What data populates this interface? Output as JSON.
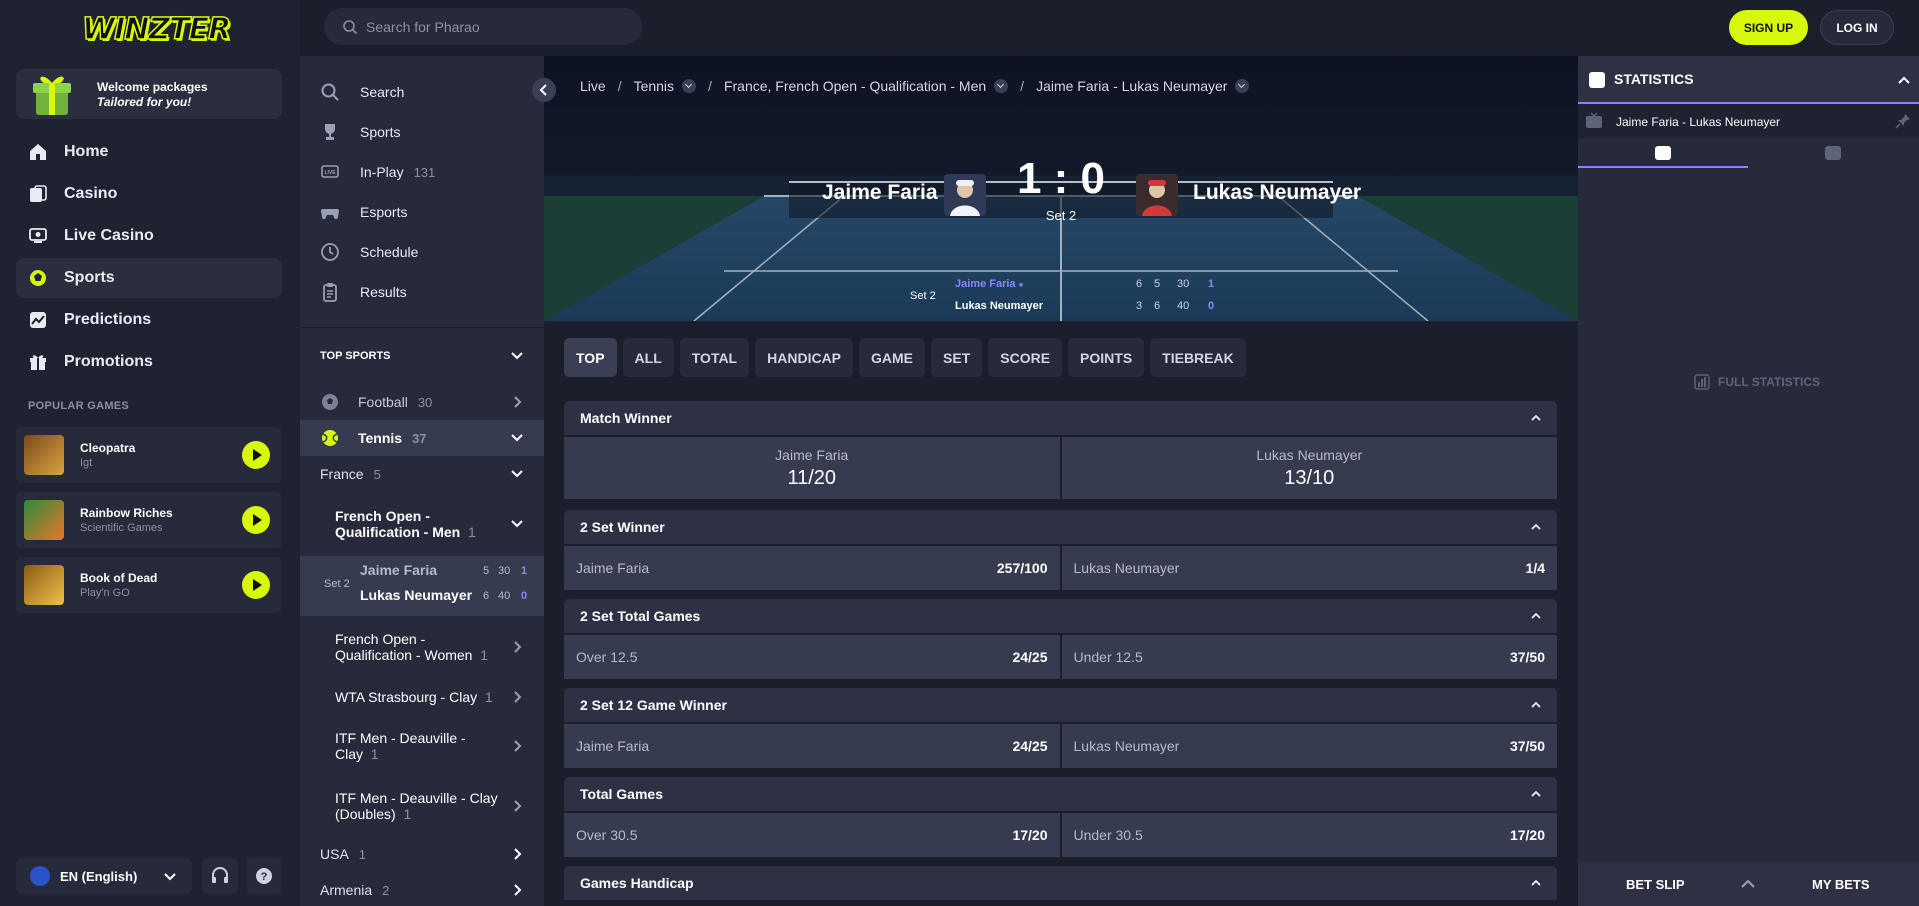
{
  "brand": {
    "logo_text": "WINZTER"
  },
  "promo": {
    "line1": "Welcome packages",
    "line2": "Tailored for you!"
  },
  "main_nav": [
    {
      "label": "Home",
      "icon": "home-icon"
    },
    {
      "label": "Casino",
      "icon": "casino-icon"
    },
    {
      "label": "Live Casino",
      "icon": "live-casino-icon"
    },
    {
      "label": "Sports",
      "icon": "sports-ball-icon",
      "active": true
    },
    {
      "label": "Predictions",
      "icon": "predictions-icon"
    },
    {
      "label": "Promotions",
      "icon": "gift-icon"
    }
  ],
  "popular_games": {
    "title": "POPULAR GAMES",
    "items": [
      {
        "name": "Cleopatra",
        "provider": "Igt"
      },
      {
        "name": "Rainbow Riches",
        "provider": "Scientific Games"
      },
      {
        "name": "Book of Dead",
        "provider": "Play'n GO"
      }
    ]
  },
  "language": {
    "label": "EN (English)"
  },
  "topbar": {
    "search_placeholder": "Search for Pharao",
    "signup_label": "SIGN UP",
    "login_label": "LOG IN"
  },
  "sports_nav": {
    "quick": [
      {
        "label": "Search",
        "icon": "search-icon"
      },
      {
        "label": "Sports",
        "icon": "trophy-icon"
      },
      {
        "label": "In-Play",
        "count": "131",
        "icon": "live-icon"
      },
      {
        "label": "Esports",
        "icon": "gamepad-icon"
      },
      {
        "label": "Schedule",
        "icon": "clock-icon"
      },
      {
        "label": "Results",
        "icon": "clipboard-icon"
      }
    ],
    "top_sports_title": "TOP SPORTS",
    "football": {
      "label": "Football",
      "count": "30"
    },
    "tennis": {
      "label": "Tennis",
      "count": "37"
    },
    "france": {
      "label": "France",
      "count": "5"
    },
    "tournament": {
      "label": "French Open - Qualification - Men",
      "count": "1"
    },
    "live_match": {
      "set": "Set 2",
      "player1": "Jaime Faria",
      "player2": "Lukas Neumayer",
      "p1_games": "5",
      "p1_points": "30",
      "p1_sets": "1",
      "p2_games": "6",
      "p2_points": "40",
      "p2_sets": "0"
    },
    "others": [
      {
        "label": "French Open - Qualification - Women",
        "count": "1"
      },
      {
        "label": "WTA Strasbourg - Clay",
        "count": "1"
      },
      {
        "label": "ITF Men - Deauville - Clay",
        "count": "1"
      },
      {
        "label": "ITF Men - Deauville - Clay (Doubles)",
        "count": "1"
      }
    ],
    "countries": [
      {
        "label": "USA",
        "count": "1"
      },
      {
        "label": "Armenia",
        "count": "2"
      }
    ]
  },
  "breadcrumb": [
    "Live",
    "Tennis",
    "France, French Open - Qualification - Men",
    "Jaime Faria - Lukas Neumayer"
  ],
  "scoreboard": {
    "home": "Jaime Faria",
    "away": "Lukas Neumayer",
    "score": "1 : 0",
    "set_label": "Set 2",
    "detail_set": "Set 2",
    "home_row": [
      "6",
      "5",
      "30",
      "1"
    ],
    "away_row": [
      "3",
      "6",
      "40",
      "0"
    ]
  },
  "market_tabs": [
    "TOP",
    "ALL",
    "TOTAL",
    "HANDICAP",
    "GAME",
    "SET",
    "SCORE",
    "POINTS",
    "TIEBREAK"
  ],
  "markets": {
    "match_winner": {
      "title": "Match Winner",
      "home": "Jaime Faria",
      "home_odds": "11/20",
      "away": "Lukas Neumayer",
      "away_odds": "13/10"
    },
    "set2_winner": {
      "title": "2 Set Winner",
      "left": "Jaime Faria",
      "left_odds": "257/100",
      "right": "Lukas Neumayer",
      "right_odds": "1/4"
    },
    "set2_total": {
      "title": "2 Set Total Games",
      "left": "Over 12.5",
      "left_odds": "24/25",
      "right": "Under 12.5",
      "right_odds": "37/50"
    },
    "set2_game12": {
      "title": "2 Set 12 Game Winner",
      "left": "Jaime Faria",
      "left_odds": "24/25",
      "right": "Lukas Neumayer",
      "right_odds": "37/50"
    },
    "total_games": {
      "title": "Total Games",
      "left": "Over 30.5",
      "left_odds": "17/20",
      "right": "Under 30.5",
      "right_odds": "17/20"
    },
    "games_handicap": {
      "title": "Games Handicap"
    }
  },
  "statistics": {
    "title": "STATISTICS",
    "match": "Jaime Faria - Lukas Neumayer",
    "full_label": "FULL STATISTICS"
  },
  "betslip": {
    "bet_slip": "BET SLIP",
    "my_bets": "MY BETS"
  },
  "colors": {
    "accent": "#d7f80b",
    "highlight": "#8d83ff",
    "panel": "#262a3a",
    "bg": "#1b1e2b"
  }
}
